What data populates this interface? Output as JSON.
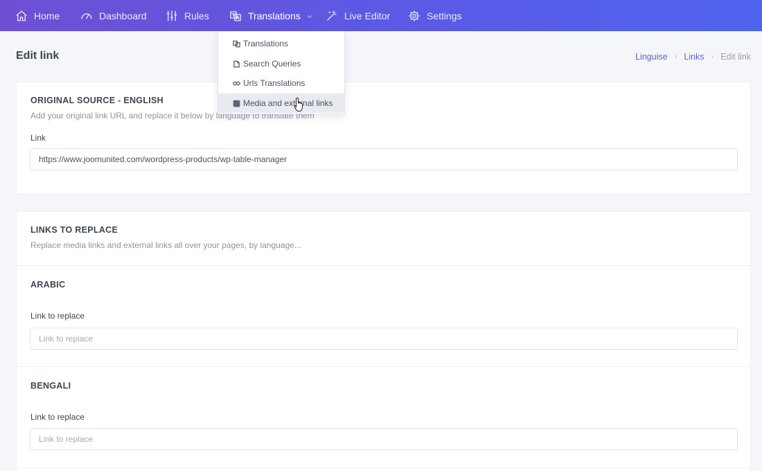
{
  "nav": {
    "home": "Home",
    "dashboard": "Dashboard",
    "rules": "Rules",
    "translations": "Translations",
    "live_editor": "Live Editor",
    "settings": "Settings"
  },
  "dropdown": {
    "items": [
      "Translations",
      "Search Queries",
      "Urls Translations",
      "Media and external links"
    ],
    "hovered_index": 3
  },
  "page": {
    "title": "Edit link"
  },
  "breadcrumb": {
    "items": [
      "Linguise",
      "Links",
      "Edit link"
    ]
  },
  "original_source": {
    "title": "ORIGINAL SOURCE - ENGLISH",
    "description": "Add your original link URL and replace it below by language to translate them",
    "link_label": "Link",
    "link_value": "https://www.joomunited.com/wordpress-products/wp-table-manager"
  },
  "links_to_replace": {
    "title": "LINKS TO REPLACE",
    "description": "Replace media links and external links all over your pages, by language...",
    "languages": [
      {
        "name": "ARABIC",
        "label": "Link to replace",
        "placeholder": "Link to replace",
        "value": ""
      },
      {
        "name": "BENGALI",
        "label": "Link to replace",
        "placeholder": "Link to replace",
        "value": ""
      }
    ]
  },
  "colors": {
    "nav_start": "#6e4fd4",
    "nav_end": "#4f63ee",
    "link": "#5a64d8"
  },
  "icons": {
    "home": "home-icon",
    "dashboard": "gauge-icon",
    "rules": "sliders-icon",
    "translations": "translate-icon",
    "live_editor": "magic-wand-icon",
    "settings": "gear-icon"
  }
}
